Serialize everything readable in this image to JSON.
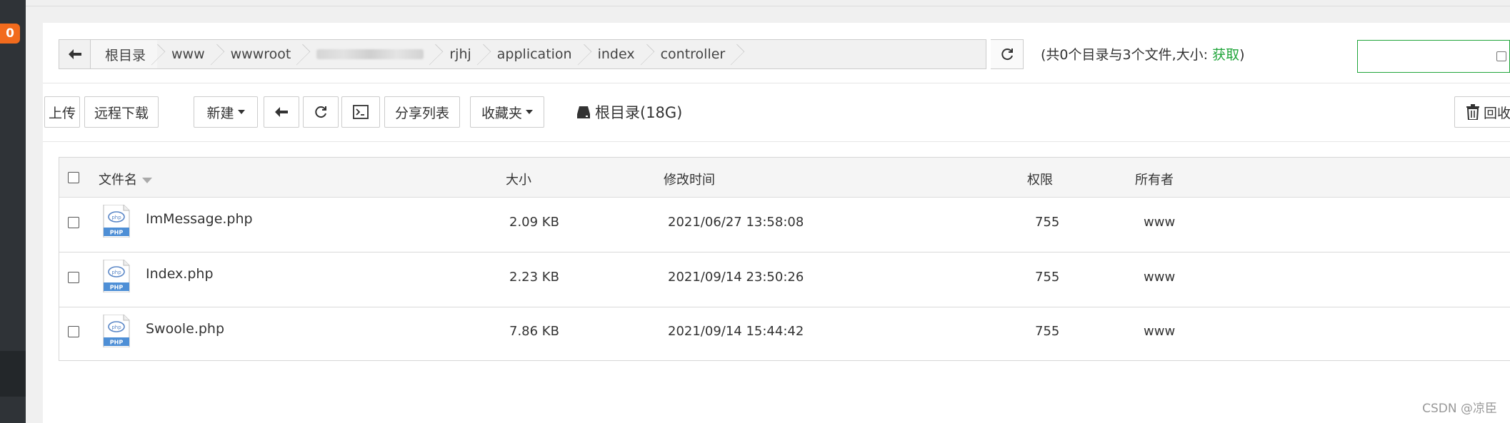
{
  "sidebar": {
    "badge_count": "0"
  },
  "path_bar": {
    "crumbs": [
      "根目录",
      "www",
      "wwwroot",
      "",
      "rjhj",
      "application",
      "index",
      "controller"
    ],
    "back_icon": "arrow-left-icon",
    "refresh_icon": "refresh-icon"
  },
  "summary": {
    "text": "(共0个目录与3个文件,大小: ",
    "fetch_label": "获取",
    "close": ")"
  },
  "toolbar": {
    "upload": "上传",
    "remote_download": "远程下载",
    "new": "新建",
    "share_list": "分享列表",
    "favorites": "收藏夹",
    "disk_label": "根目录(18G)",
    "recycle": "回收"
  },
  "table": {
    "headers": {
      "name": "文件名",
      "size": "大小",
      "mtime": "修改时间",
      "perm": "权限",
      "owner": "所有者"
    },
    "rows": [
      {
        "name": "ImMessage.php",
        "size": "2.09 KB",
        "mtime": "2021/06/27 13:58:08",
        "perm": "755",
        "owner": "www",
        "icon_label": "PHP"
      },
      {
        "name": "Index.php",
        "size": "2.23 KB",
        "mtime": "2021/09/14 23:50:26",
        "perm": "755",
        "owner": "www",
        "icon_label": "PHP"
      },
      {
        "name": "Swoole.php",
        "size": "7.86 KB",
        "mtime": "2021/09/14 15:44:42",
        "perm": "755",
        "owner": "www",
        "icon_label": "PHP"
      }
    ]
  },
  "watermark": "CSDN @凉臣",
  "colors": {
    "accent_green": "#20a53a",
    "badge_orange": "#f26b1d",
    "sidebar_dark": "#2f3337"
  }
}
